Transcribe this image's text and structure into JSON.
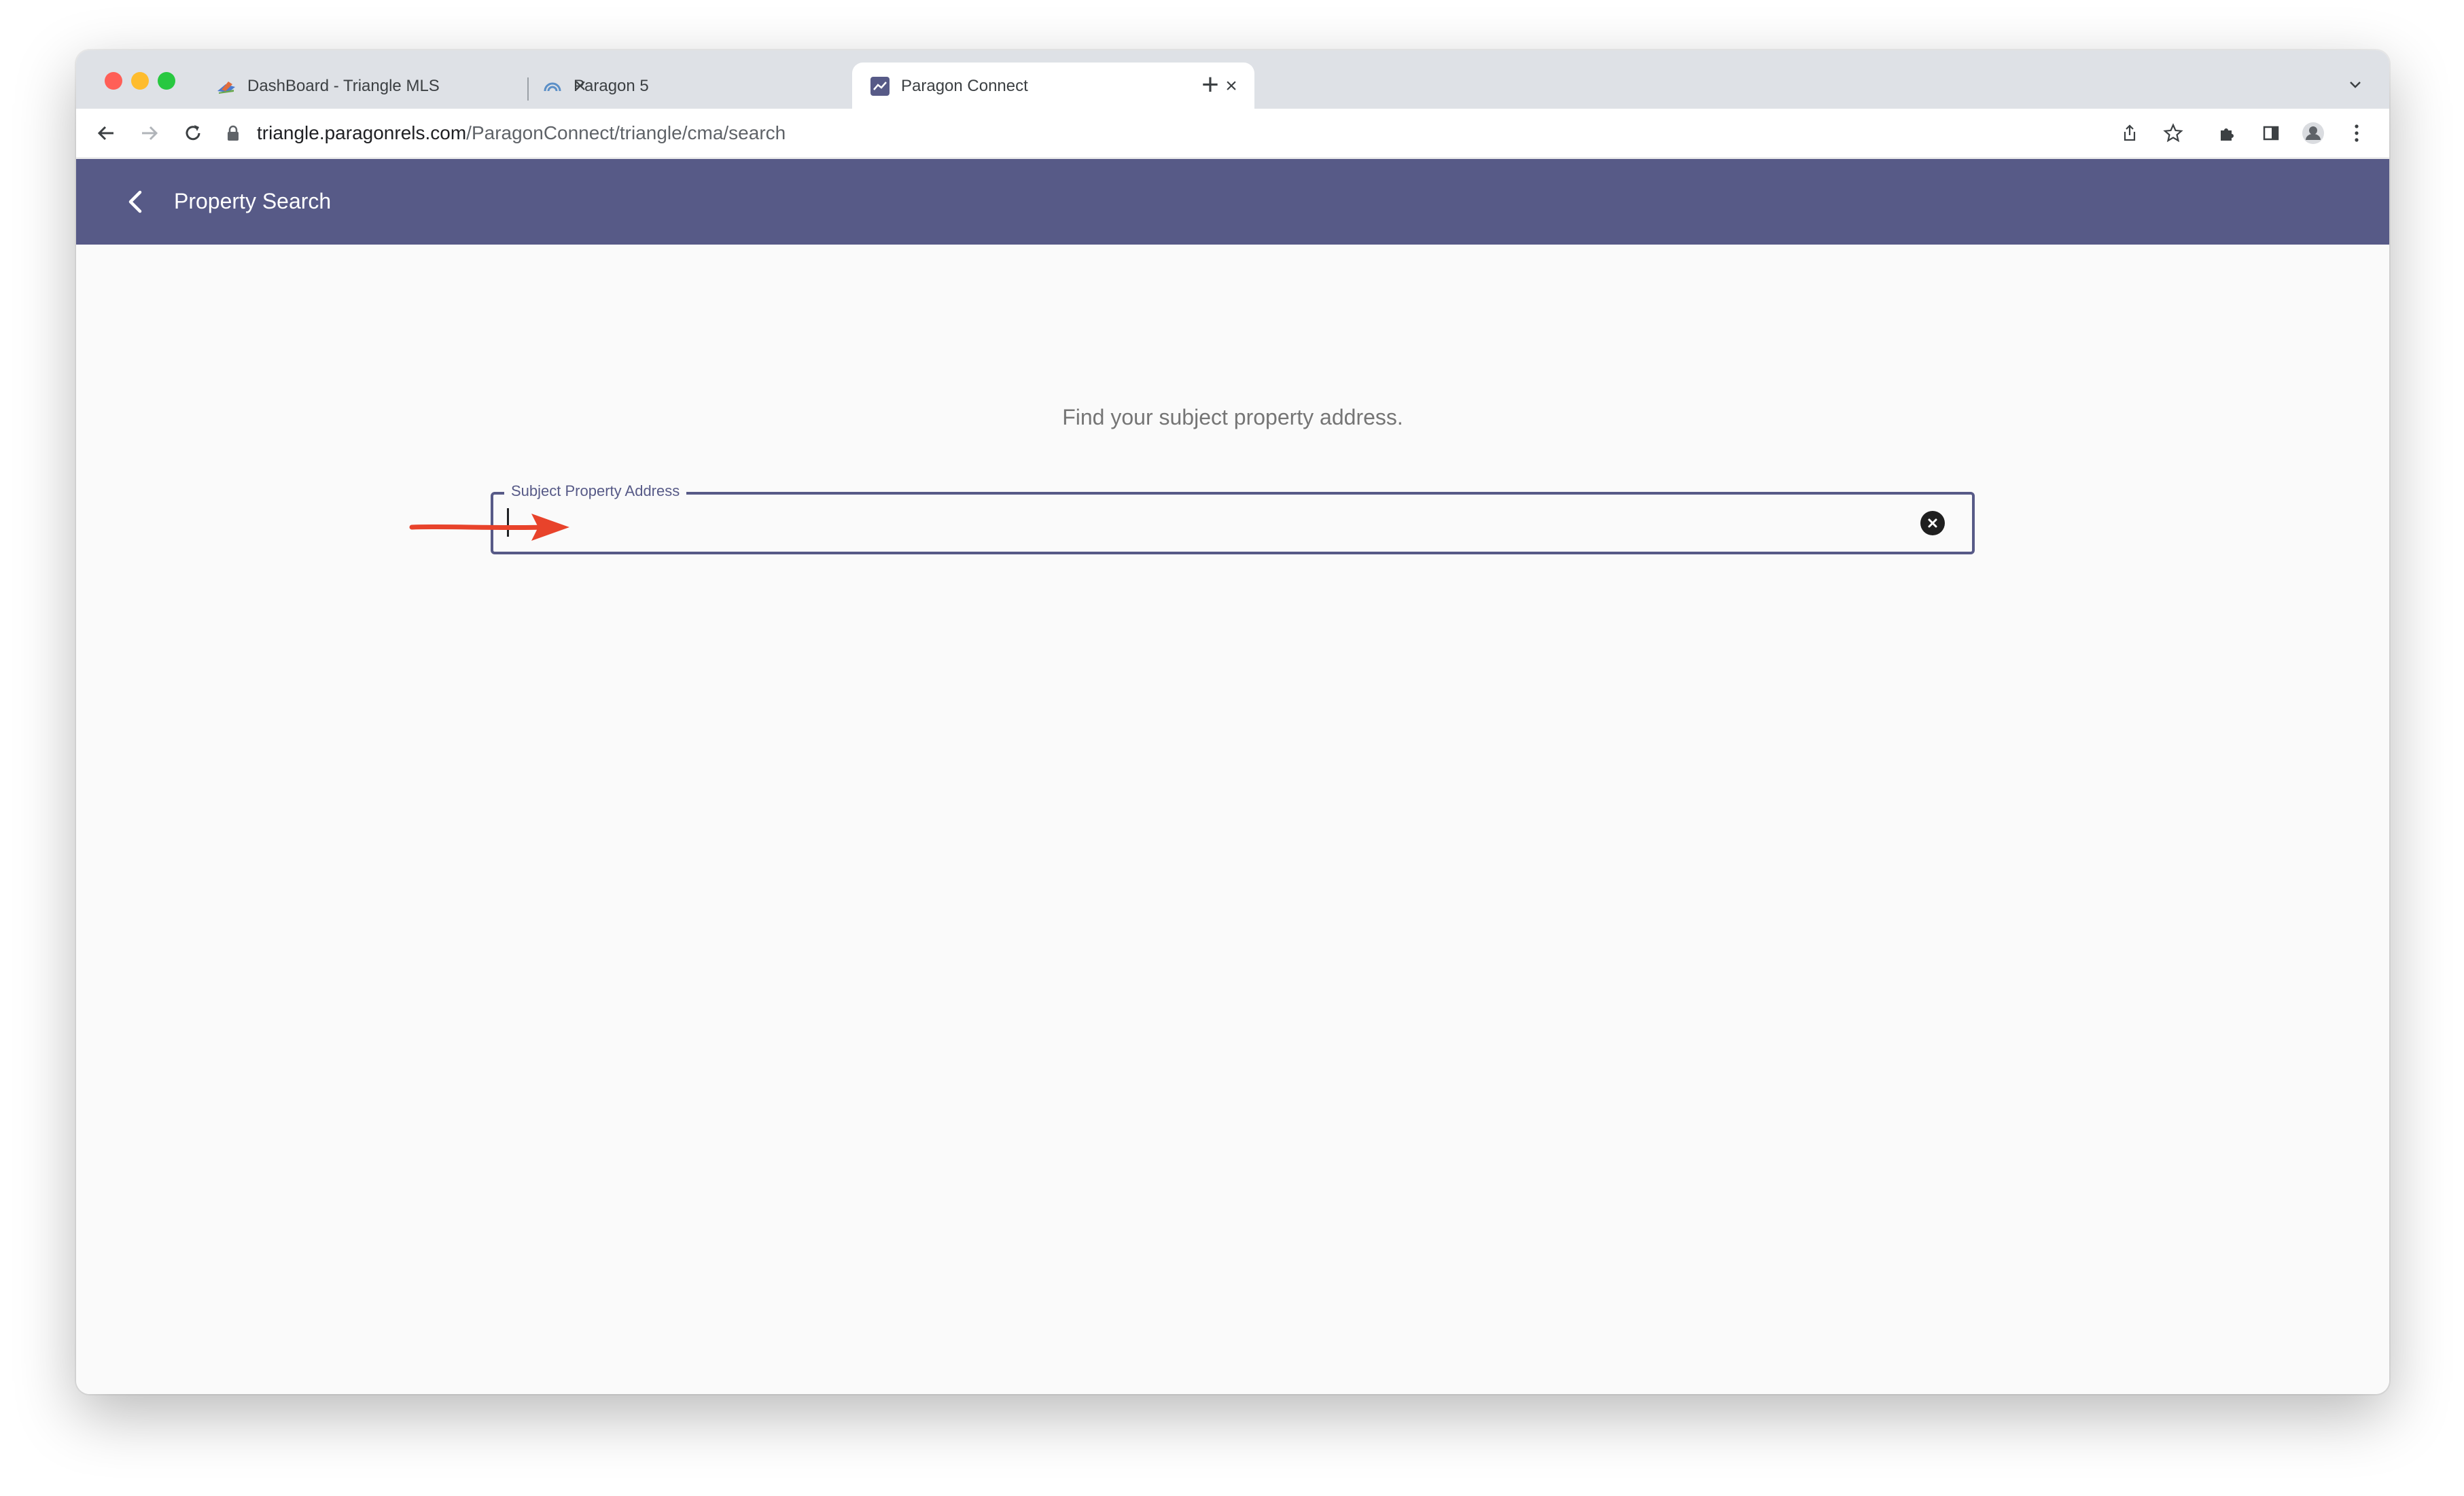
{
  "browser": {
    "tabs": [
      {
        "title": "DashBoard - Triangle MLS",
        "active": false
      },
      {
        "title": "Paragon 5",
        "active": false
      },
      {
        "title": "Paragon Connect",
        "active": true
      }
    ],
    "url_domain": "triangle.paragonrels.com",
    "url_path": "/ParagonConnect/triangle/cma/search"
  },
  "app": {
    "header_title": "Property Search",
    "header_color": "#575a87",
    "prompt": "Find your subject property address.",
    "address_field": {
      "label": "Subject Property Address",
      "value": "",
      "placeholder": ""
    }
  },
  "annotation": {
    "color": "#e8432b"
  }
}
